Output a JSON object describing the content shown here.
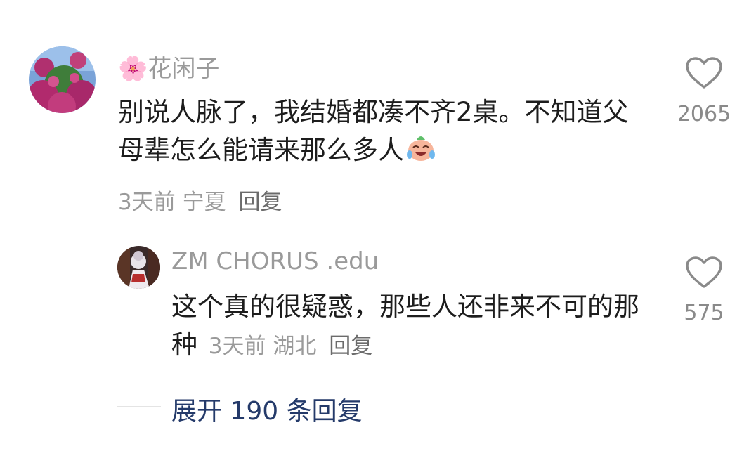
{
  "comment": {
    "username": "花闲子",
    "username_emoji": "🌸",
    "text": "别说人脉了，我结婚都凑不齐2桌。不知道父母辈怎么能请来那么多人",
    "text_emoji": "crying-laughing-face-icon",
    "time": "3天前",
    "location": "宁夏",
    "reply_label": "回复",
    "likes": "2065"
  },
  "reply": {
    "username": "ZM CHORUS .edu",
    "text": "这个真的很疑惑，那些人还非来不可的那种",
    "time": "3天前",
    "location": "湖北",
    "reply_label": "回复",
    "likes": "575"
  },
  "expand": {
    "label": "展开 190 条回复"
  },
  "colors": {
    "username": "#9a9a9a",
    "text": "#1d1d1d",
    "meta": "#9a9a9a",
    "expand": "#243a6a"
  }
}
